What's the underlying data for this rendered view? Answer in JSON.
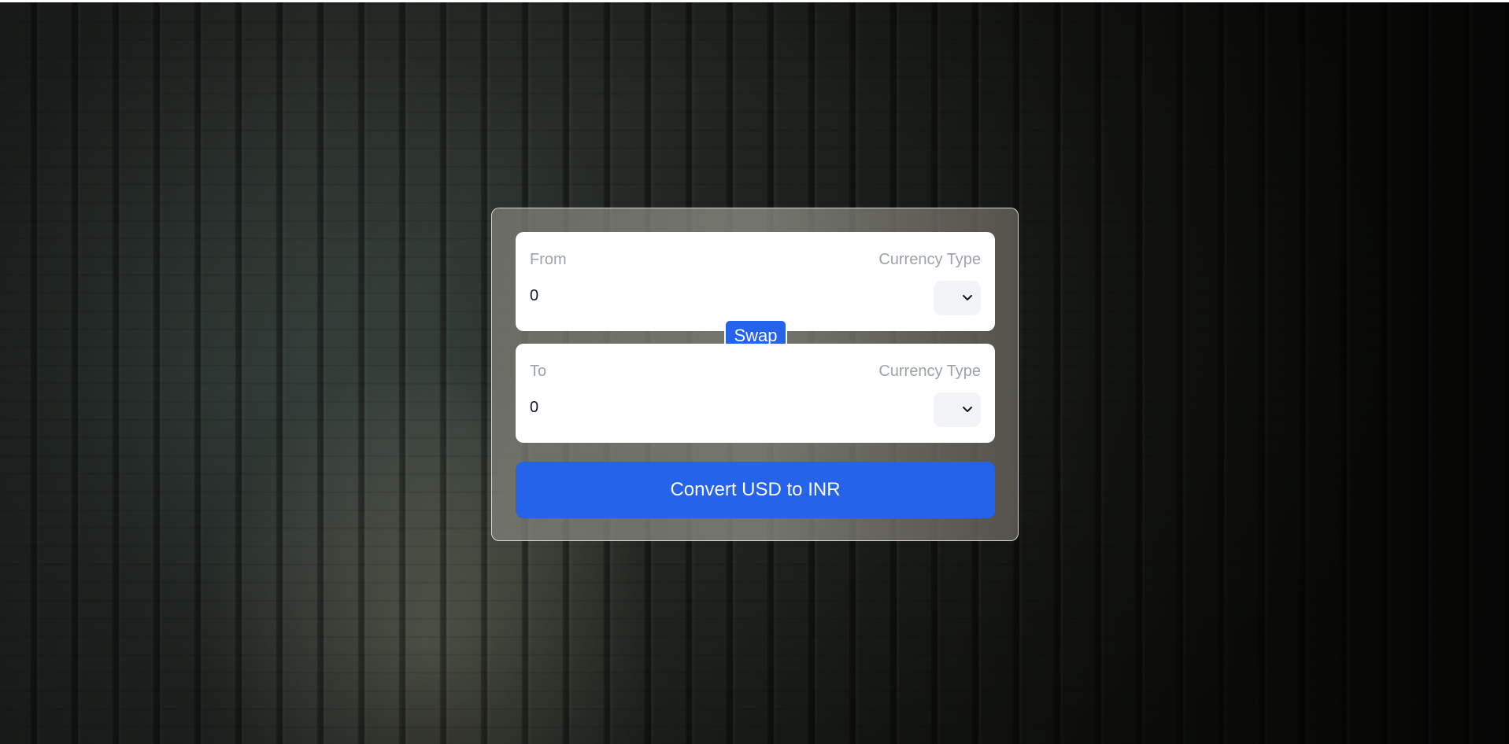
{
  "converter": {
    "from": {
      "label": "From",
      "currency_label": "Currency Type",
      "amount": "0"
    },
    "to": {
      "label": "To",
      "currency_label": "Currency Type",
      "amount": "0"
    },
    "swap_label": "Swap",
    "convert_label": "Convert USD to INR"
  },
  "colors": {
    "accent": "#2563eb",
    "panel": "#ffffff",
    "label": "#9ca3af",
    "select_bg": "#f3f4f6"
  },
  "icons": {
    "from_select": "chevron-down-icon",
    "to_select": "chevron-down-icon"
  }
}
